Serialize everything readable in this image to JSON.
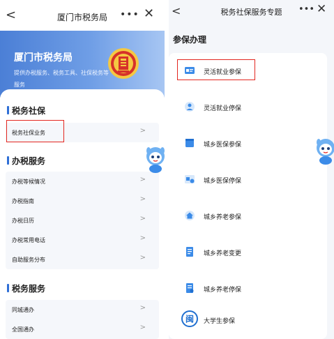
{
  "left": {
    "nav": {
      "back": "<",
      "title": "厦门市税务局",
      "more": "•••",
      "close": "✕"
    },
    "banner": {
      "title": "厦门市税务局",
      "subtitle": "提供办税服务、税务工具、社保税务等服务"
    },
    "sections": [
      {
        "title": "税务社保",
        "items": [
          {
            "label": "税务社保业务"
          }
        ]
      },
      {
        "title": "办税服务",
        "items": [
          {
            "label": "办税等候情况"
          },
          {
            "label": "办税指南"
          },
          {
            "label": "办税日历"
          },
          {
            "label": "办税常用电话"
          },
          {
            "label": "自助服务分布"
          }
        ]
      },
      {
        "title": "税务服务",
        "items": [
          {
            "label": "同城通办"
          },
          {
            "label": "全国通办"
          }
        ]
      }
    ],
    "chevron": ">"
  },
  "right": {
    "nav": {
      "back": "<",
      "title": "税务社保服务专题",
      "more": "•••",
      "close": "✕"
    },
    "section_title": "参保办理",
    "items": [
      {
        "label": "灵活就业参保",
        "icon": "card-icon"
      },
      {
        "label": "灵活就业停保",
        "icon": "pause-user-icon"
      },
      {
        "label": "城乡医保参保",
        "icon": "medical-card-icon"
      },
      {
        "label": "城乡医保停保",
        "icon": "medical-stop-icon"
      },
      {
        "label": "城乡养老参保",
        "icon": "house-icon"
      },
      {
        "label": "城乡养老变更",
        "icon": "document-edit-icon"
      },
      {
        "label": "城乡养老停保",
        "icon": "document-stop-icon"
      },
      {
        "label": "大学生参保",
        "icon": "min-logo-icon",
        "logo_char": "闽"
      }
    ]
  },
  "colors": {
    "accent": "#2f6fd6",
    "highlight": "#e3261f",
    "icon_blue": "#3b8be8"
  }
}
